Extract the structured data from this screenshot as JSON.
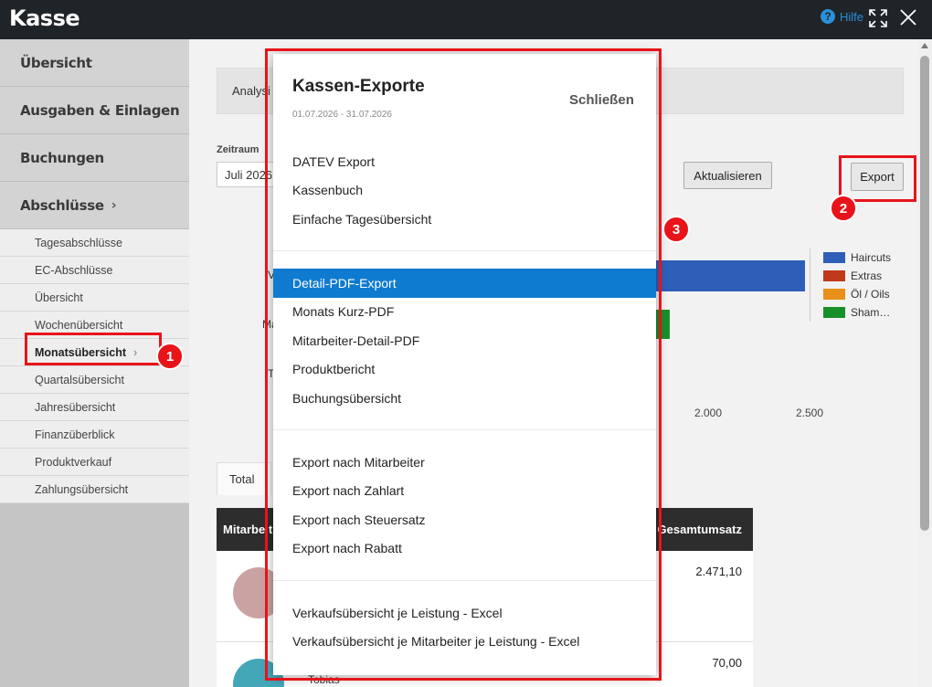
{
  "app": {
    "title": "Kasse",
    "help_label": "Hilfe"
  },
  "sidebar": {
    "items": [
      {
        "label": "Übersicht"
      },
      {
        "label": "Ausgaben & Einlagen"
      },
      {
        "label": "Buchungen"
      },
      {
        "label": "Abschlüsse",
        "chevron": "›"
      }
    ],
    "sub_items": [
      {
        "label": "Tagesabschlüsse"
      },
      {
        "label": "EC-Abschlüsse"
      },
      {
        "label": "Übersicht"
      },
      {
        "label": "Wochenübersicht"
      },
      {
        "label": "Monatsübersicht",
        "chevron": "›",
        "active": true
      },
      {
        "label": "Quartalsübersicht"
      },
      {
        "label": "Jahresübersicht"
      },
      {
        "label": "Finanzüberblick"
      },
      {
        "label": "Produktverkauf"
      },
      {
        "label": "Zahlungsübersicht"
      }
    ]
  },
  "main": {
    "analysis_label": "Analysi",
    "zeitraum_label": "Zeitraum",
    "zeitraum_value": "Juli 2026",
    "refresh_button": "Aktualisieren",
    "export_button": "Export",
    "row_labels_cut": [
      "V",
      "Ma",
      "T"
    ],
    "tab_total": "Total",
    "table": {
      "col_left": "Mitarbeit",
      "col_right": "Gesamtumsatz",
      "rows": [
        {
          "value": "2.471,10",
          "name": ""
        },
        {
          "value": "70,00",
          "name": "Tobias"
        }
      ]
    }
  },
  "chart_data": {
    "type": "bar",
    "orientation": "horizontal",
    "stacked": true,
    "x_ticks": [
      "2.000",
      "2.500"
    ],
    "series": [
      {
        "name": "Haircuts",
        "color": "#2e5fb8"
      },
      {
        "name": "Extras",
        "color": "#c0391b"
      },
      {
        "name": "Öl / Oils",
        "color": "#e8901a"
      },
      {
        "name": "Sham…",
        "color": "#18902a"
      }
    ]
  },
  "modal": {
    "title": "Kassen-Exporte",
    "date_range": "01.07.2026 - 31.07.2026",
    "close_label": "Schließen",
    "sections": [
      {
        "items": [
          "DATEV Export",
          "Kassenbuch",
          "Einfache Tagesübersicht"
        ]
      },
      {
        "items": [
          "Detail-PDF-Export",
          "Monats Kurz-PDF",
          "Mitarbeiter-Detail-PDF",
          "Produktbericht",
          "Buchungsübersicht"
        ]
      },
      {
        "items": [
          "Export nach Mitarbeiter",
          "Export nach Zahlart",
          "Export nach Steuersatz",
          "Export nach Rabatt"
        ]
      },
      {
        "items": [
          "Verkaufsübersicht je Leistung - Excel",
          "Verkaufsübersicht je Mitarbeiter je Leistung - Excel"
        ]
      }
    ],
    "selected_item": "Detail-PDF-Export"
  },
  "annotations": [
    {
      "number": "1"
    },
    {
      "number": "2"
    },
    {
      "number": "3"
    }
  ],
  "colors": {
    "annotation_red": "#e8141a",
    "selected_blue": "#0f7bd0",
    "help_blue": "#2a8fd8"
  }
}
